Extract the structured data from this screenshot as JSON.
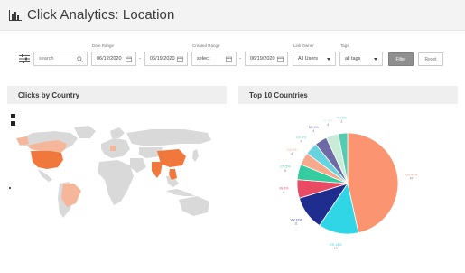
{
  "header": {
    "title": "Click Analytics: Location",
    "icon": "bar-chart-icon"
  },
  "filters": {
    "search": {
      "placeholder": "search"
    },
    "date_range": {
      "label": "Date Range",
      "start": "06/12/2020",
      "end": "06/19/2020"
    },
    "created_range": {
      "label": "Created Range",
      "start": "select",
      "end": "06/19/2020"
    },
    "link_owner": {
      "label": "Link Owner",
      "value": "All Users"
    },
    "tags": {
      "label": "Tags",
      "value": "all tags"
    },
    "filter_button": "Filter",
    "reset_button": "Reset"
  },
  "left_panel": {
    "title": "Clicks by Country"
  },
  "right_panel": {
    "title": "Top 10 Countries"
  },
  "colors": {
    "header_bg": "#f3f3f3",
    "panel_bg": "#efefef",
    "map_land": "#d9d9d9",
    "map_highlight": "#f0783c"
  },
  "chart_data": {
    "type": "pie",
    "slices": [
      {
        "label": "US 47%\n47",
        "value": 47,
        "color": "#fb9470"
      },
      {
        "label": "KH 13%\n13",
        "value": 13,
        "color": "#30d5e6"
      },
      {
        "label": "VN 11%\n11",
        "value": 11,
        "color": "#1f2d8f"
      },
      {
        "label": "IN 6%\n6",
        "value": 6,
        "color": "#e84b63"
      },
      {
        "label": "CN 5%\n5",
        "value": 5,
        "color": "#35cca0"
      },
      {
        "label": "CA 4%\n4",
        "value": 4,
        "color": "#f7a98c"
      },
      {
        "label": "DE 4%\n4",
        "value": 4,
        "color": "#68d3e0"
      },
      {
        "label": "BR 4%\n4",
        "value": 4,
        "color": "#6e6aa6"
      },
      {
        "label": "FL 4%\n4",
        "value": 4,
        "color": "#c9ecd8"
      },
      {
        "label": "TH 3%\n3",
        "value": 3,
        "color": "#53ccb2"
      }
    ]
  }
}
